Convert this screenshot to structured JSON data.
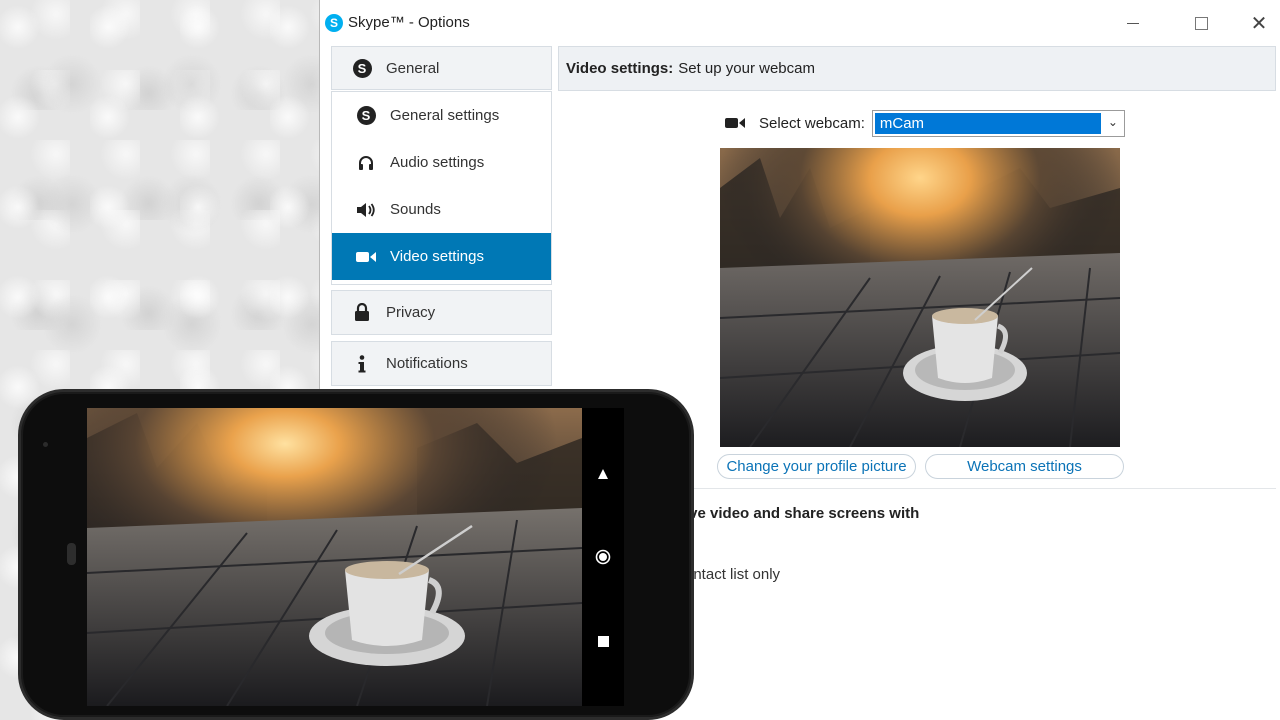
{
  "window": {
    "title": "Skype™ - Options",
    "logo_letter": "S",
    "close_glyph": "✕"
  },
  "sidebar": {
    "general_group": {
      "label": "General",
      "icon": "skype-icon"
    },
    "items": [
      {
        "label": "General settings",
        "icon": "skype-icon"
      },
      {
        "label": "Audio settings",
        "icon": "headset-icon"
      },
      {
        "label": "Sounds",
        "icon": "speaker-icon"
      },
      {
        "label": "Video settings",
        "icon": "video-camera-icon",
        "active": true
      }
    ],
    "privacy": {
      "label": "Privacy",
      "icon": "lock-icon"
    },
    "notifications": {
      "label": "Notifications",
      "icon": "info-icon"
    }
  },
  "content": {
    "header_bold": "Video settings:",
    "header_text": "Set up your webcam",
    "select_webcam_label": "Select webcam:",
    "webcam_value": "mCam",
    "change_profile_button": "Change your profile picture",
    "webcam_settings_button": "Webcam settings",
    "receive_video_text": "ive video and share screens with",
    "contact_list_text": "ontact list only"
  },
  "phone": {
    "nav_back": "back-triangle-icon",
    "nav_home": "home-circle-icon",
    "nav_recents": "recents-square-icon"
  },
  "colors": {
    "accent": "#0078b5",
    "select_highlight": "#0078d7",
    "link_blue": "#0b73b7",
    "skype_blue": "#00aff0"
  }
}
